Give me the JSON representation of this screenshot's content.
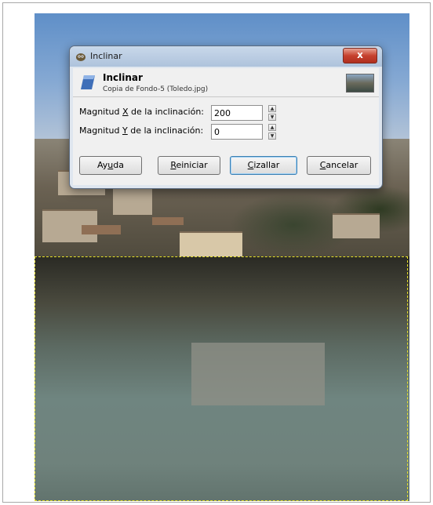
{
  "dialog": {
    "window_title": "Inclinar",
    "close_label": "x",
    "header_title": "Inclinar",
    "header_subtitle": "Copia de Fondo-5 (Toledo.jpg)",
    "fields": [
      {
        "label_before": "Magnitud ",
        "mnemonic": "X",
        "label_after": " de la inclinación:",
        "value": "200"
      },
      {
        "label_before": "Magnitud ",
        "mnemonic": "Y",
        "label_after": " de la inclinación:",
        "value": "0"
      }
    ],
    "buttons": {
      "help": {
        "before": "Ay",
        "mnemonic": "u",
        "after": "da"
      },
      "reset": {
        "before": "",
        "mnemonic": "R",
        "after": "einiciar"
      },
      "shear": {
        "before": "",
        "mnemonic": "C",
        "after": "izallar"
      },
      "cancel": {
        "before": "",
        "mnemonic": "C",
        "after": "ancelar"
      }
    }
  },
  "icons": {
    "title": "gimp-wilber-icon",
    "header": "shear-tool-icon",
    "thumbnail": "layer-thumbnail",
    "spin_up": "spin-up-icon",
    "spin_down": "spin-down-icon"
  },
  "colors": {
    "selection_marquee": "#e8e22a",
    "close_button": "#c6412e",
    "default_button_border": "#3c7fb1"
  }
}
